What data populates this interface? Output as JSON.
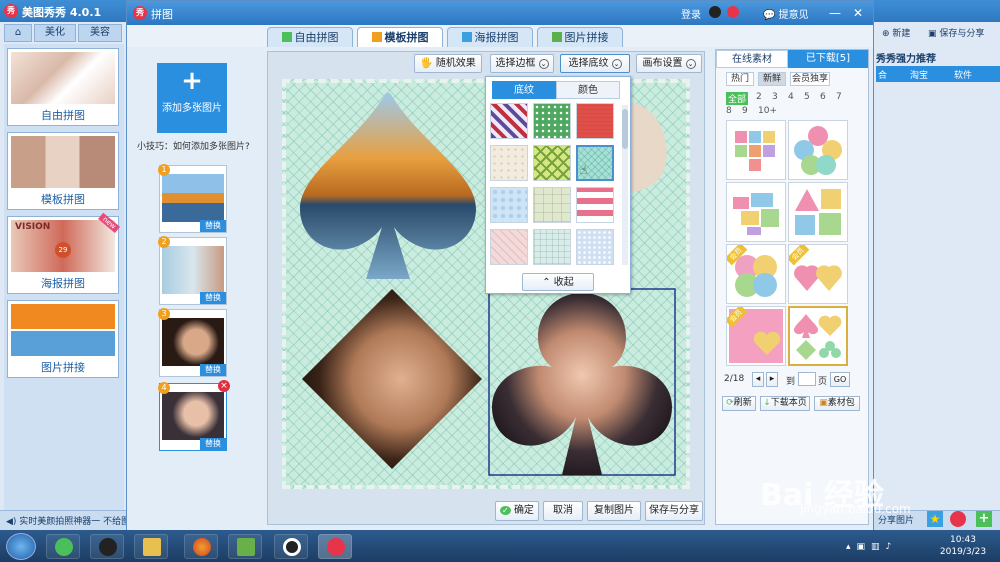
{
  "main_window": {
    "title": "美图秀秀 4.0.1",
    "tabs": [
      "⌂",
      "美化",
      "美容"
    ],
    "cards": [
      {
        "label": "自由拼图"
      },
      {
        "label": "模板拼图"
      },
      {
        "label": "海报拼图",
        "badge": "new",
        "poster_text": "VISION",
        "poster_number": "29"
      },
      {
        "label": "图片拼接"
      }
    ],
    "status_text": "实时美颜拍照神器一 不给图",
    "right_toolbar": {
      "new_label": "新建",
      "save_label": "保存与分享"
    },
    "recommend_title": "秀秀强力推荐",
    "recommend_tabs": [
      "合",
      "淘宝",
      "软件"
    ],
    "share_label": "分享图片"
  },
  "dialog": {
    "title": "拼图",
    "titlebar_links": {
      "login": "登录",
      "feedback": "提意见"
    },
    "tabs": [
      "自由拼图",
      "模板拼图",
      "海报拼图",
      "图片拼接"
    ],
    "active_tab": 1,
    "add_button": {
      "plus": "+",
      "label": "添加多张图片"
    },
    "tip": "小技巧：如何添加多张图片?",
    "thumbs": [
      {
        "num": "1",
        "replace": "替换"
      },
      {
        "num": "2",
        "replace": "替换"
      },
      {
        "num": "3",
        "replace": "替换"
      },
      {
        "num": "4",
        "replace": "替换",
        "delete": "×"
      }
    ],
    "toolbar": {
      "random": "随机效果",
      "border": "选择边框",
      "texture": "选择底纹",
      "canvas": "画布设置"
    },
    "popup": {
      "tabs": [
        "底纹",
        "颜色"
      ],
      "collapse": "收起",
      "swatch_colors": [
        "#c9a9d9",
        "#4fa860",
        "#e0504a",
        "#f2ece0",
        "#d2e880",
        "#a8e0d6",
        "#cfe5f6",
        "#dfe8cf",
        "#e8708a",
        "#f3dada",
        "#d9ece9",
        "#cfe0f2"
      ]
    },
    "materials": {
      "tabs": [
        "在线素材",
        "已下载[5]"
      ],
      "filters": [
        "热门",
        "新鲜",
        "会员独享"
      ],
      "pages": [
        "全部",
        "2",
        "3",
        "4",
        "5",
        "6",
        "7",
        "8",
        "9",
        "10+"
      ],
      "vip_label": "会员",
      "pager_label": "2/18",
      "page_prefix": "到",
      "page_suffix": "页",
      "go": "GO",
      "actions": [
        "刷新",
        "下载本页",
        "素材包"
      ]
    },
    "bottom_buttons": {
      "confirm": "确定",
      "cancel": "取消",
      "copy": "复制图片",
      "save": "保存与分享"
    }
  },
  "taskbar": {
    "time": "10:43",
    "date": "2019/3/23"
  },
  "watermark": {
    "main": "Bai 经验",
    "url": "jingyan.baidu.com"
  }
}
